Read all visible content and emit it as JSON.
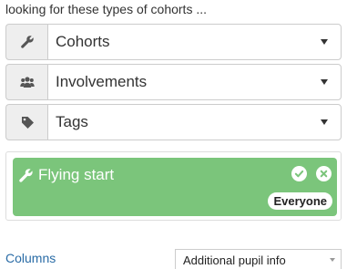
{
  "heading": "looking for these types of cohorts ...",
  "filters": [
    {
      "label": "Cohorts",
      "icon": "wrench-icon"
    },
    {
      "label": "Involvements",
      "icon": "users-icon"
    },
    {
      "label": "Tags",
      "icon": "tag-icon"
    }
  ],
  "cohort_card": {
    "title": "Flying start",
    "badge": "Everyone",
    "color": "#7bc57b"
  },
  "columns": {
    "label": "Columns",
    "selected": "Additional pupil info"
  }
}
